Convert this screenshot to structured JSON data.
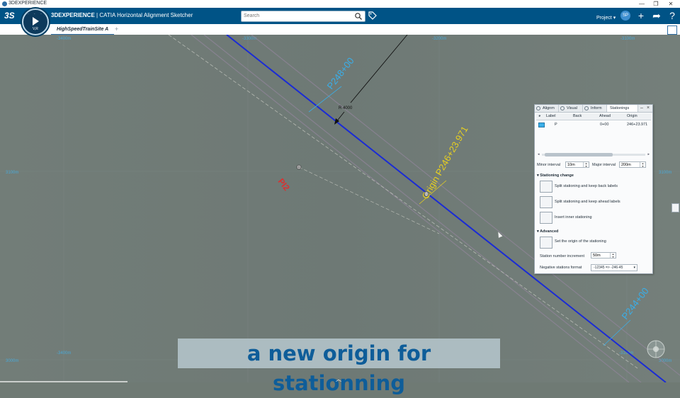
{
  "window": {
    "title": "3DEXPERIENCE",
    "controls": [
      "—",
      "❐",
      "✕"
    ]
  },
  "header": {
    "brand": "3DEXPERIENCE",
    "app_name": " | CATIA Horizontal Alignment Sketcher",
    "compass_label": "V,R",
    "search_placeholder": "Search",
    "project_label": "Project",
    "avatar_initials": "SP",
    "colors": {
      "header_bg": "#005386",
      "accent": "#2e6da4"
    }
  },
  "tabs": {
    "document": "HighSpeedTrainSite A",
    "add": "+"
  },
  "viewport": {
    "grid_labels": {
      "top": [
        "-3400m",
        "-3300m",
        "-3200m",
        "-3100m"
      ],
      "bottom": [
        "-3400m",
        "-3100m"
      ],
      "left": [
        "3100m",
        "3000m"
      ],
      "right": [
        "3100m",
        "3000m"
      ]
    },
    "station_labels": [
      "P248+00",
      "P244+00"
    ],
    "origin_label": "Origin P246+23.971",
    "radius_label": "R 4000",
    "pi_label": "PI2",
    "colors": {
      "alignment": "#1a2bd6",
      "station": "#3aaee8",
      "origin": "#e8d020",
      "pi": "#d83232"
    }
  },
  "panel": {
    "tabs": [
      "Alignm",
      "Visual",
      "Inform",
      "Stationings"
    ],
    "columns": [
      "Label",
      "Back",
      "Ahead",
      "Origin"
    ],
    "rows": [
      {
        "label": "P",
        "back": "",
        "ahead": "0+00",
        "origin": "246+23.971"
      }
    ],
    "minor_interval_label": "Minor interval",
    "minor_interval_value": "10m",
    "major_interval_label": "Major interval",
    "major_interval_value": "200m",
    "section_stationing": "Stationing change",
    "actions": [
      "Split stationing and keep back labels",
      "Split stationing and keep ahead labels",
      "Insert inner stationing"
    ],
    "section_advanced": "Advanced",
    "set_origin": "Set the origin of the stationing",
    "station_increment_label": "Station number increment",
    "station_increment_value": "50m",
    "negative_format_label": "Negative stations format",
    "negative_format_value": "-12345 => -246-45"
  },
  "caption": "a new origin for stationning"
}
